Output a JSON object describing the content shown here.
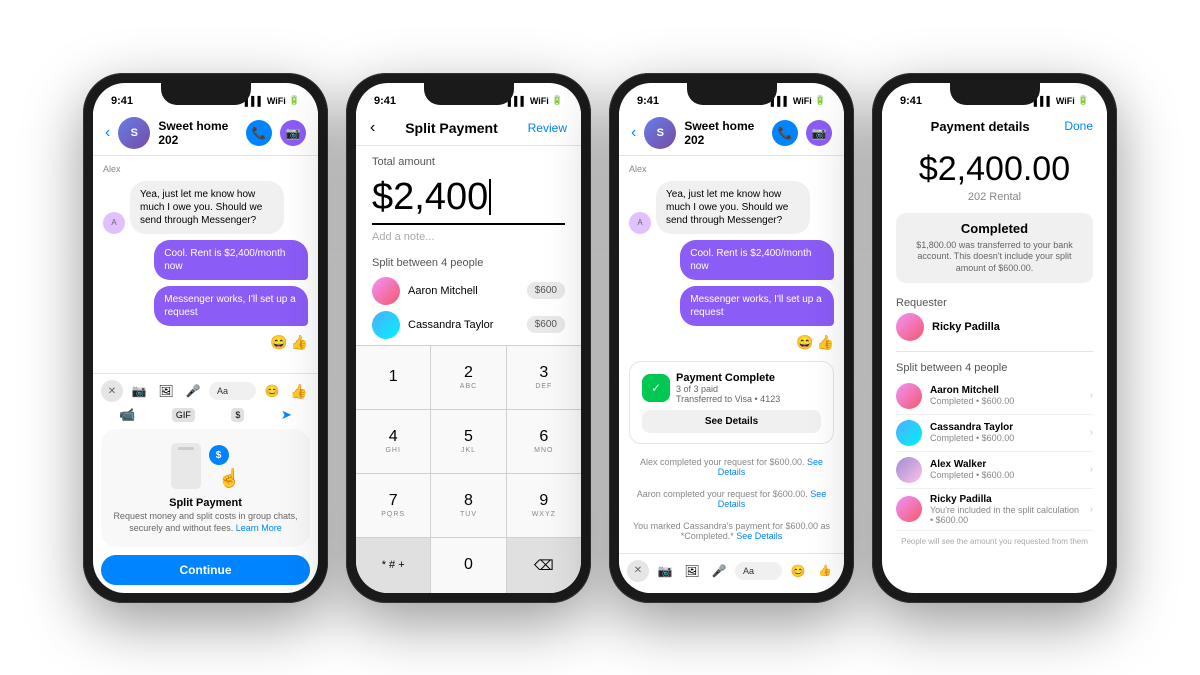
{
  "phones": {
    "p1": {
      "time": "9:41",
      "chat_name": "Sweet home 202",
      "messages": [
        {
          "type": "label",
          "text": "Alex"
        },
        {
          "type": "received",
          "text": "Yea, just let me know how much I owe you. Should we send through Messenger?"
        },
        {
          "type": "sent",
          "text": "Cool. Rent is $2,400/month now"
        },
        {
          "type": "sent",
          "text": "Messenger works, I'll set up a request"
        }
      ],
      "toolbar": {
        "placeholder": "Aa"
      },
      "feature": {
        "title": "Split Payment",
        "desc": "Request money and split costs in group chats, securely and without fees.",
        "link": "Learn More",
        "btn": "Continue"
      }
    },
    "p2": {
      "time": "9:41",
      "header_title": "Split Payment",
      "header_review": "Review",
      "total_amount_label": "Total amount",
      "amount": "$2,400",
      "note_placeholder": "Add a note...",
      "split_label": "Split between 4 people",
      "people": [
        {
          "name": "Aaron Mitchell",
          "amount": "$600"
        },
        {
          "name": "Cassandra Taylor",
          "amount": "$600"
        }
      ],
      "numpad": [
        {
          "top": "1",
          "sub": ""
        },
        {
          "top": "2",
          "sub": "ABC"
        },
        {
          "top": "3",
          "sub": "DEF"
        },
        {
          "top": "4",
          "sub": "GHI"
        },
        {
          "top": "5",
          "sub": "JKL"
        },
        {
          "top": "6",
          "sub": "MNO"
        },
        {
          "top": "7",
          "sub": "PQRS"
        },
        {
          "top": "8",
          "sub": "TUV"
        },
        {
          "top": "9",
          "sub": "WXYZ"
        },
        {
          "top": "* # +",
          "sub": ""
        },
        {
          "top": "0",
          "sub": ""
        },
        {
          "top": "⌫",
          "sub": ""
        }
      ]
    },
    "p3": {
      "time": "9:41",
      "chat_name": "Sweet home 202",
      "messages": [
        {
          "type": "label",
          "text": "Alex"
        },
        {
          "type": "received",
          "text": "Yea, just let me know how much I owe you. Should we send through Messenger?"
        },
        {
          "type": "sent",
          "text": "Cool. Rent is $2,400/month now"
        },
        {
          "type": "sent",
          "text": "Messenger works, I'll set up a request"
        }
      ],
      "payment_card": {
        "title": "Payment Complete",
        "subtitle": "3 of 3 paid",
        "transfer": "Transferred to Visa • 4123",
        "btn": "See Details"
      },
      "status_messages": [
        "Alex completed your request for $600.00. See Details",
        "Aaron completed your request for $600.00. See Details",
        "You marked Cassandra's payment for $600.00 as *Completed.* See Details"
      ]
    },
    "p4": {
      "time": "9:41",
      "header_title": "Payment details",
      "header_done": "Done",
      "amount": "$2,400.00",
      "rental": "202 Rental",
      "status_title": "Completed",
      "status_desc": "$1,800.00 was transferred to your bank account. This doesn't include your split amount of $600.00.",
      "requester_label": "Requester",
      "requester_name": "Ricky Padilla",
      "split_label": "Split between 4 people",
      "people": [
        {
          "name": "Aaron Mitchell",
          "status": "Completed • $600.00"
        },
        {
          "name": "Cassandra Taylor",
          "status": "Completed • $600.00"
        },
        {
          "name": "Alex Walker",
          "status": "Completed • $600.00"
        },
        {
          "name": "Ricky Padilla",
          "status": "You're included in the split calculation • $600.00"
        }
      ],
      "footer_note": "People will see the amount you requested from them"
    }
  }
}
